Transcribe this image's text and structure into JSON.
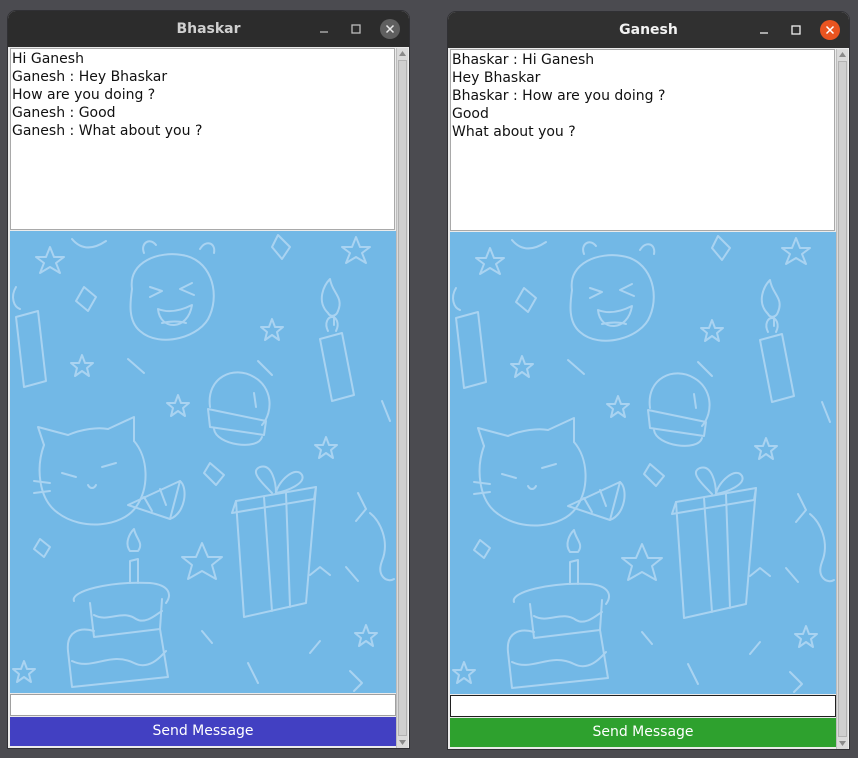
{
  "windows": [
    {
      "title": "Bhaskar",
      "messages": [
        "Hi Ganesh",
        "Ganesh : Hey Bhaskar",
        "How are you doing ?",
        "Ganesh : Good",
        "Ganesh : What about you ?"
      ],
      "input_value": "",
      "send_label": "Send Message",
      "send_color": "#4240c2"
    },
    {
      "title": "Ganesh",
      "messages": [
        "Bhaskar : Hi Ganesh",
        "Hey Bhaskar",
        "Bhaskar : How are you doing ?",
        "Good",
        "What about you ?"
      ],
      "input_value": "",
      "send_label": "Send Message",
      "send_color": "#2ea12e"
    }
  ],
  "theme": {
    "titlebar_color": "#2c2c2c",
    "wallpaper_color": "#72b8e6",
    "close_active_color": "#e95420"
  },
  "icons": {
    "minimize": "minimize-icon",
    "maximize": "maximize-icon",
    "close": "close-icon",
    "scroll_up": "arrow-up-icon",
    "scroll_down": "arrow-down-icon",
    "wallpaper_motifs": [
      "crying-face-icon",
      "candle-icon",
      "cat-icon",
      "party-horn-icon",
      "gift-box-icon",
      "cake-icon",
      "crystal-ball-icon",
      "star-icon",
      "confetti-icon"
    ]
  }
}
